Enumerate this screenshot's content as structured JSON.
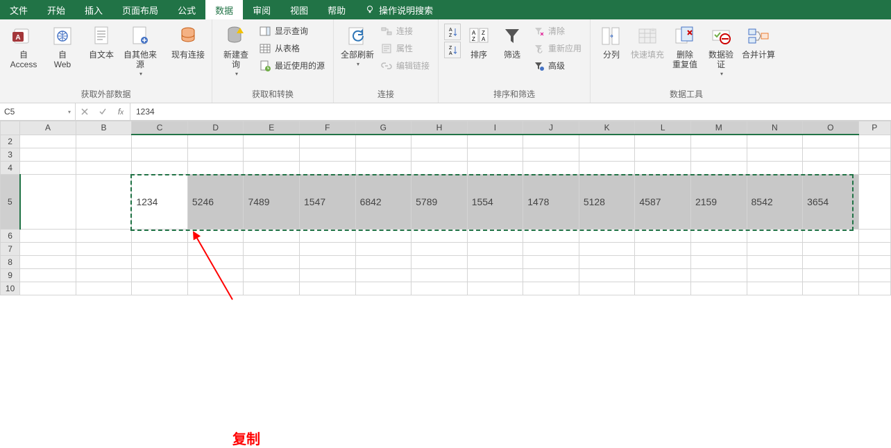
{
  "tabs": {
    "file": "文件",
    "home": "开始",
    "insert": "插入",
    "layout": "页面布局",
    "formulas": "公式",
    "data": "数据",
    "review": "审阅",
    "view": "视图",
    "help": "帮助",
    "tell": "操作说明搜索"
  },
  "ribbon": {
    "get_ext": {
      "access": "自 Access",
      "web": "自\nWeb",
      "text": "自文本",
      "other": "自其他来源",
      "existing": "现有连接",
      "label": "获取外部数据"
    },
    "get_transform": {
      "newquery": "新建查\n询",
      "show": "显示查询",
      "fromtable": "从表格",
      "recent": "最近使用的源",
      "label": "获取和转换"
    },
    "connections": {
      "refresh": "全部刷新",
      "conn": "连接",
      "props": "属性",
      "edit": "编辑链接",
      "label": "连接"
    },
    "sortfilter": {
      "sort": "排序",
      "filter": "筛选",
      "clear": "清除",
      "reapply": "重新应用",
      "adv": "高级",
      "label": "排序和筛选"
    },
    "datatools": {
      "texttocol": "分列",
      "flashfill": "快速填充",
      "dedup": "删除\n重复值",
      "validation": "数据验\n证",
      "consolidate": "合并计算",
      "label": "数据工具"
    }
  },
  "formula_bar": {
    "name": "C5",
    "value": "1234"
  },
  "columns": [
    "A",
    "B",
    "C",
    "D",
    "E",
    "F",
    "G",
    "H",
    "I",
    "J",
    "K",
    "L",
    "M",
    "N",
    "O",
    "P"
  ],
  "row5_values": [
    "1234",
    "5246",
    "7489",
    "1547",
    "6842",
    "5789",
    "1554",
    "1478",
    "5128",
    "4587",
    "2159",
    "8542",
    "3654"
  ],
  "annotation": "复制"
}
